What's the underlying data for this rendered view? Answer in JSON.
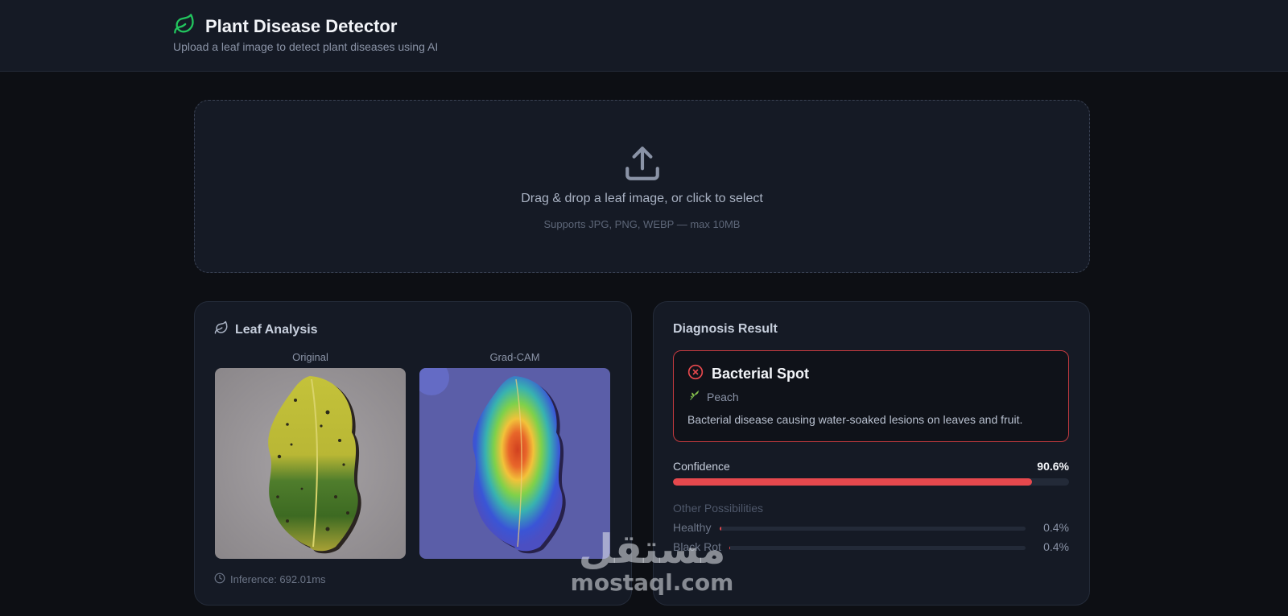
{
  "app": {
    "title": "Plant Disease Detector",
    "subtitle": "Upload a leaf image to detect plant diseases using AI",
    "icon": "leaf-icon"
  },
  "dropzone": {
    "title": "Drag & drop a leaf image, or click to select",
    "subtitle": "Supports JPG, PNG, WEBP — max 10MB",
    "icon": "upload-icon"
  },
  "analysis": {
    "title": "Leaf Analysis",
    "original_label": "Original",
    "gradcam_label": "Grad-CAM",
    "inference": "Inference: 692.01ms"
  },
  "result": {
    "title": "Diagnosis Result",
    "disease": "Bacterial Spot",
    "plant": "Peach",
    "description": "Bacterial disease causing water-soaked lesions on leaves and fruit.",
    "confidence_label": "Confidence",
    "confidence_text": "90.6%",
    "confidence": 0.906,
    "other_label": "Other Possibilities",
    "possibilities": [
      {
        "name": "Healthy",
        "value_text": "0.4%",
        "value": 0.004
      },
      {
        "name": "Black Rot",
        "value_text": "0.4%",
        "value": 0.004
      }
    ],
    "accent_color": "#e5484d"
  },
  "watermark": {
    "arabic": "مستقل",
    "latin": "mostaql.com"
  }
}
